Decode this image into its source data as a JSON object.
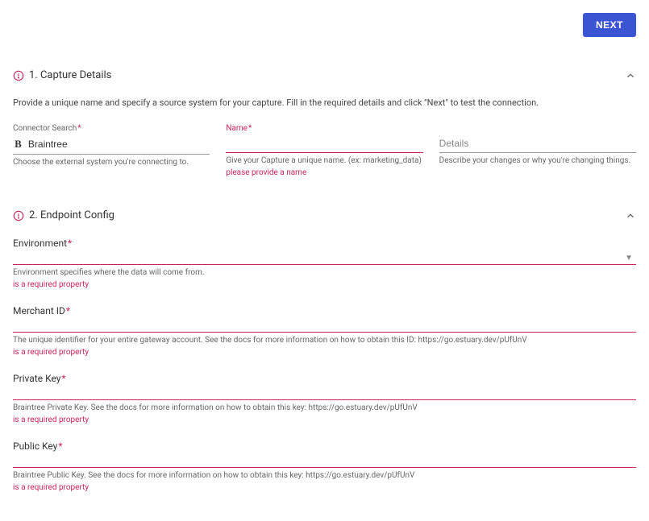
{
  "header": {
    "next_label": "NEXT"
  },
  "section1": {
    "title": "1. Capture Details",
    "instructions": "Provide a unique name and specify a source system for your capture. Fill in the required details and click \"Next\" to test the connection.",
    "connector": {
      "label": "Connector Search",
      "value": "Braintree",
      "help": "Choose the external system you're connecting to."
    },
    "name": {
      "label": "Name",
      "help": "Give your Capture a unique name. (ex: marketing_data)",
      "error": "please provide a name"
    },
    "details": {
      "placeholder": "Details",
      "help": "Describe your changes or why you're changing things."
    }
  },
  "section2": {
    "title": "2. Endpoint Config",
    "fields": [
      {
        "label": "Environment",
        "required": true,
        "dropdown": true,
        "help": "Environment specifies where the data will come from.",
        "error": "is a required property"
      },
      {
        "label": "Merchant ID",
        "required": true,
        "dropdown": false,
        "help": "The unique identifier for your entire gateway account. See the docs for more information on how to obtain this ID: https://go.estuary.dev/pUfUnV",
        "error": "is a required property"
      },
      {
        "label": "Private Key",
        "required": true,
        "dropdown": false,
        "help": "Braintree Private Key. See the docs for more information on how to obtain this key: https://go.estuary.dev/pUfUnV",
        "error": "is a required property"
      },
      {
        "label": "Public Key",
        "required": true,
        "dropdown": false,
        "help": "Braintree Public Key. See the docs for more information on how to obtain this key: https://go.estuary.dev/pUfUnV",
        "error": "is a required property"
      }
    ]
  },
  "asterisk": "*"
}
